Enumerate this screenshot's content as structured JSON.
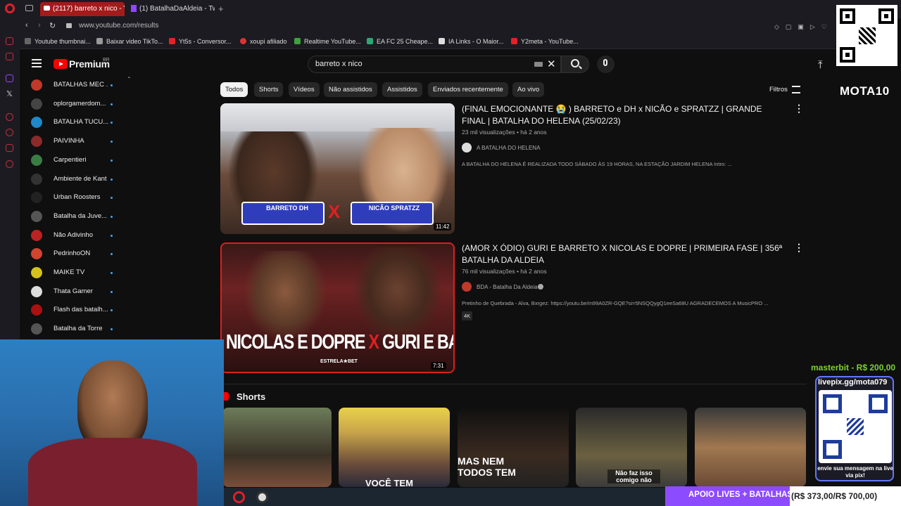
{
  "browser": {
    "tabs": [
      {
        "label": "(2117) barreto x nico - You"
      },
      {
        "label": "(1) BatalhaDaAldeia - Twit"
      }
    ],
    "url": "www.youtube.com/results",
    "bookmarks": [
      {
        "label": "Youtube thumbnai...",
        "color": "#666"
      },
      {
        "label": "Baixar video TikTo...",
        "color": "#999"
      },
      {
        "label": "Yt5s - Conversor...",
        "color": "#e02424"
      },
      {
        "label": "xoupi afiliado",
        "color": "#d33"
      },
      {
        "label": "Realtime YouTube...",
        "color": "#3ba33b"
      },
      {
        "label": "EA FC 25 Cheape...",
        "color": "#2aa876"
      },
      {
        "label": "IA Links - O Maior...",
        "color": "#ddd"
      },
      {
        "label": "Y2meta - YouTube...",
        "color": "#e02424"
      }
    ]
  },
  "youtube": {
    "brand": "Premium",
    "country": "BR",
    "search_query": "barreto x nico",
    "subscriptions": [
      {
        "name": "BATALHAS MEC ...",
        "color": "#c0392b"
      },
      {
        "name": "oplorgamerdom...",
        "color": "#444"
      },
      {
        "name": "BATALHA TUCU...",
        "color": "#1e88c9"
      },
      {
        "name": "PAIVINHA",
        "color": "#8b2a2a"
      },
      {
        "name": "Carpentieri",
        "color": "#3a7d44"
      },
      {
        "name": "Ambiente de Kant",
        "color": "#333"
      },
      {
        "name": "Urban Roosters",
        "color": "#222"
      },
      {
        "name": "Batalha da Juve...",
        "color": "#555"
      },
      {
        "name": "Não Adivinho",
        "color": "#b22"
      },
      {
        "name": "PedrinhoON",
        "color": "#d0452e"
      },
      {
        "name": "MAIKE TV",
        "color": "#d4c21b"
      },
      {
        "name": "Thata Gamer",
        "color": "#ddd"
      },
      {
        "name": "Flash das batalh...",
        "color": "#a11"
      },
      {
        "name": "Batalha da Torre",
        "color": "#555"
      }
    ],
    "chips": [
      "Todos",
      "Shorts",
      "Vídeos",
      "Não assistidos",
      "Assistidos",
      "Enviados recentemente",
      "Ao vivo"
    ],
    "filters_label": "Filtros",
    "results": [
      {
        "title": "(FINAL EMOCIONANTE 😭 ) BARRETO e DH x NICÃO e SPRATZZ | GRANDE FINAL | BATALHA DO HELENA (25/02/23)",
        "views": "23 mil visualizações",
        "age": "há 2 anos",
        "channel": "A BATALHA DO HELENA",
        "description": "A BATALHA DO HELENA É REALIZADA TODO SÁBADO ÀS 19 HORAS, NA ESTAÇÃO JARDIM HELENA Intro: ...",
        "duration": "11:42",
        "thumb_left": "BARRETO DH",
        "thumb_right": "NICÃO SPRATZZ",
        "thumb_x": "X"
      },
      {
        "title": "(AMOR X ÓDIO) GURI E BARRETO X NICOLAS E DOPRE | PRIMEIRA FASE | 356ª BATALHA DA ALDEIA",
        "views": "76 mil visualizações",
        "age": "há 2 anos",
        "channel": "BDA - Batalha Da Aldeia",
        "description": "Pretinho de Quebrada - Alva, Bxrgez: https://youtu.be/m99A0ZR-GQE?si=5NSQQygQ1eeSa68U AGRADECEMOS A MusicPRO ...",
        "badge": "4K",
        "duration": "7:31",
        "thumb_caption_a": "NICOLAS E DOPRE",
        "thumb_caption_x": "X",
        "thumb_caption_b": "GURI E BARRETO",
        "thumb_sponsor": "ESTRELA★BET"
      }
    ],
    "shorts_title": "Shorts",
    "shorts": [
      {
        "caption": ""
      },
      {
        "caption": "VOCÊ TEM"
      },
      {
        "caption": "MAS NEM TODOS TEM"
      },
      {
        "caption": "Não faz isso comigo não"
      },
      {
        "caption": ""
      }
    ]
  },
  "stream_overlay": {
    "handle": "MOTA10",
    "donation": "masterbit - R$ 200,00",
    "pix_url": "livepix.gg/mota079",
    "pix_caption": "envie sua mensagem na live via pix!",
    "goal_label": "APOIO LIVES + BATALHAS",
    "goal_amount": "(R$ 373,00/R$ 700,00)",
    "goal_progress": 0.53
  }
}
